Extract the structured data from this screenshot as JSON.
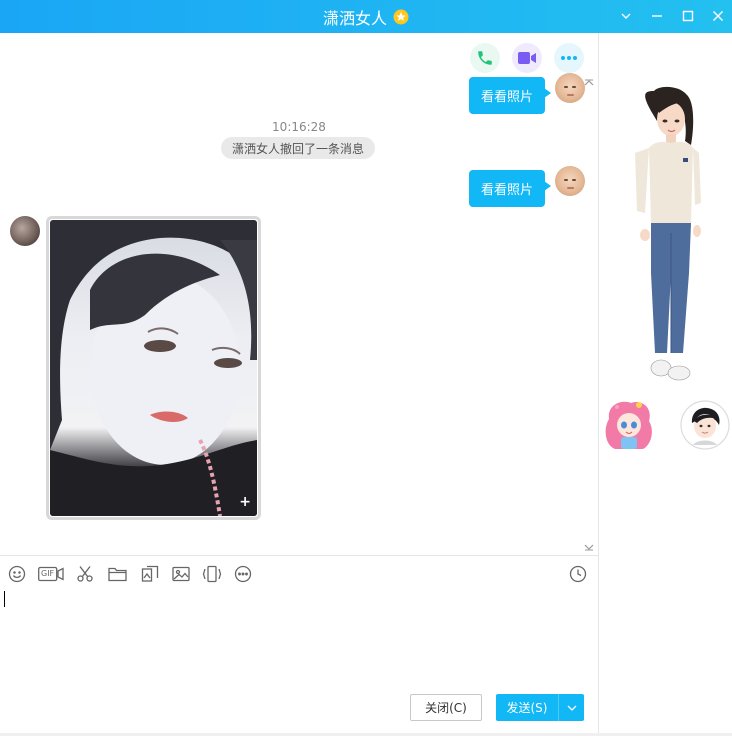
{
  "window": {
    "title": "潇洒女人",
    "icons": [
      "vip-star-icon",
      "chevron-down-icon",
      "minimize-icon",
      "maximize-icon",
      "close-icon"
    ]
  },
  "call_actions": [
    "phone-icon",
    "video-icon",
    "more-icon"
  ],
  "messages": [
    {
      "type": "outgoing",
      "text": "看看照片"
    },
    {
      "type": "timestamp",
      "text": "10:16:28"
    },
    {
      "type": "system",
      "text": "潇洒女人撤回了一条消息"
    },
    {
      "type": "outgoing",
      "text": "看看照片"
    },
    {
      "type": "incoming-image",
      "expand_glyph": "+"
    }
  ],
  "toolbar": {
    "gif_label": "GIF",
    "icons": [
      "emoji-icon",
      "gif-icon",
      "screenshot-icon",
      "folder-icon",
      "image-edit-icon",
      "picture-icon",
      "shake-icon",
      "more-icon",
      "history-icon"
    ]
  },
  "buttons": {
    "close": "关闭(C)",
    "send": "发送(S)"
  },
  "colors": {
    "accent": "#12b7f5",
    "titlebar_start": "#1aa6f5",
    "titlebar_end": "#23c0f0",
    "phone": "#22c27a",
    "video": "#7a5cf2",
    "more": "#12b7f5"
  }
}
